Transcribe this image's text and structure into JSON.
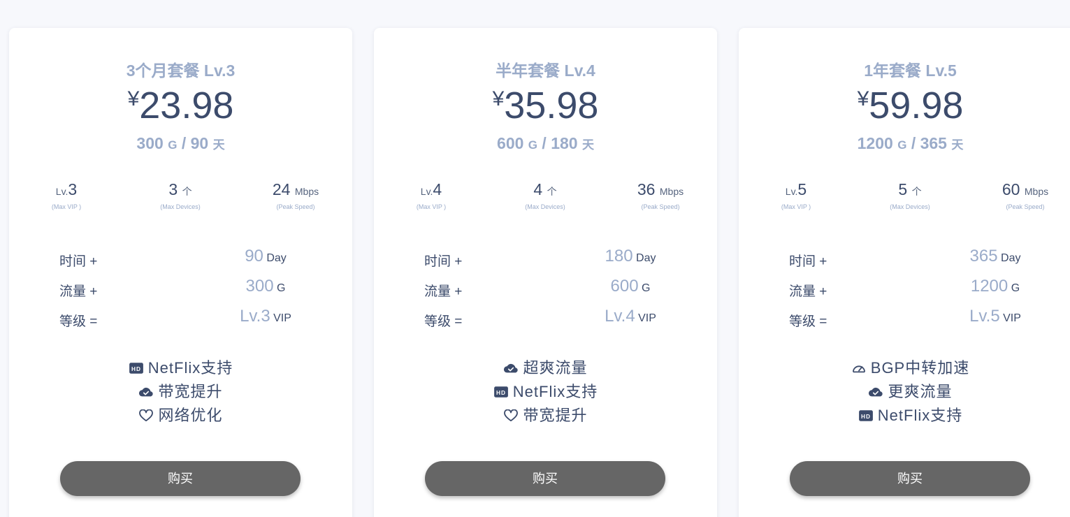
{
  "plans": [
    {
      "title": "3个月套餐 Lv.3",
      "currency": "¥",
      "price": "23.98",
      "traffic": "300",
      "traffic_unit": "G",
      "sep": "/",
      "days": "90",
      "days_unit": "天",
      "stats": [
        {
          "prefix": "Lv.",
          "value": "3",
          "suffix": "",
          "sub": "(Max VIP )"
        },
        {
          "prefix": "",
          "value": "3",
          "suffix": "个",
          "sub": "(Max Devices)"
        },
        {
          "prefix": "",
          "value": "24",
          "suffix": "Mbps",
          "sub": "(Peak Speed)"
        }
      ],
      "rows": [
        {
          "label": "时间 +",
          "value": "90",
          "unit": "Day"
        },
        {
          "label": "流量 +",
          "value": "300",
          "unit": "G"
        },
        {
          "label": "等级 =",
          "value": "Lv.3",
          "unit": "VIP"
        }
      ],
      "features": [
        {
          "icon": "hd-icon",
          "text": "NetFlix支持"
        },
        {
          "icon": "cloud-check-icon",
          "text": "带宽提升"
        },
        {
          "icon": "heart-icon",
          "text": "网络优化"
        }
      ],
      "button": "购买"
    },
    {
      "title": "半年套餐 Lv.4",
      "currency": "¥",
      "price": "35.98",
      "traffic": "600",
      "traffic_unit": "G",
      "sep": "/",
      "days": "180",
      "days_unit": "天",
      "stats": [
        {
          "prefix": "Lv.",
          "value": "4",
          "suffix": "",
          "sub": "(Max VIP )"
        },
        {
          "prefix": "",
          "value": "4",
          "suffix": "个",
          "sub": "(Max Devices)"
        },
        {
          "prefix": "",
          "value": "36",
          "suffix": "Mbps",
          "sub": "(Peak Speed)"
        }
      ],
      "rows": [
        {
          "label": "时间 +",
          "value": "180",
          "unit": "Day"
        },
        {
          "label": "流量 +",
          "value": "600",
          "unit": "G"
        },
        {
          "label": "等级 =",
          "value": "Lv.4",
          "unit": "VIP"
        }
      ],
      "features": [
        {
          "icon": "cloud-check-icon",
          "text": "超爽流量"
        },
        {
          "icon": "hd-icon",
          "text": "NetFlix支持"
        },
        {
          "icon": "heart-icon",
          "text": "带宽提升"
        }
      ],
      "button": "购买"
    },
    {
      "title": "1年套餐 Lv.5",
      "currency": "¥",
      "price": "59.98",
      "traffic": "1200",
      "traffic_unit": "G",
      "sep": "/",
      "days": "365",
      "days_unit": "天",
      "stats": [
        {
          "prefix": "Lv.",
          "value": "5",
          "suffix": "",
          "sub": "(Max VIP )"
        },
        {
          "prefix": "",
          "value": "5",
          "suffix": "个",
          "sub": "(Max Devices)"
        },
        {
          "prefix": "",
          "value": "60",
          "suffix": "Mbps",
          "sub": "(Peak Speed)"
        }
      ],
      "rows": [
        {
          "label": "时间 +",
          "value": "365",
          "unit": "Day"
        },
        {
          "label": "流量 +",
          "value": "1200",
          "unit": "G"
        },
        {
          "label": "等级 =",
          "value": "Lv.5",
          "unit": "VIP"
        }
      ],
      "features": [
        {
          "icon": "speedometer-icon",
          "text": "BGP中转加速"
        },
        {
          "icon": "cloud-check-icon",
          "text": "更爽流量"
        },
        {
          "icon": "hd-icon",
          "text": "NetFlix支持"
        }
      ],
      "button": "购买"
    }
  ]
}
